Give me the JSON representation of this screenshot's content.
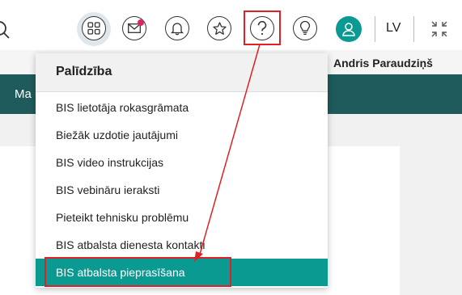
{
  "header": {
    "user_name": "Andris Paraudziņš",
    "language": "LV",
    "icons": [
      "search-icon",
      "apps-icon",
      "messages-icon",
      "bell-icon",
      "star-icon",
      "help-icon",
      "lightbulb-icon",
      "user-avatar-icon",
      "collapse-icon"
    ],
    "notification_color": "#e0245e"
  },
  "nav": {
    "label_fragment": "Ma"
  },
  "help_menu": {
    "title": "Palīdzība",
    "items": [
      "BIS lietotāja rokasgrāmata",
      "Biežāk uzdotie jautājumi",
      "BIS video instrukcijas",
      "BIS vebināru ieraksti",
      "Pieteikt tehnisku problēmu",
      "BIS atbalsta dienesta kontakti",
      "BIS atbalsta pieprasīšana"
    ],
    "selected_index": 6
  },
  "colors": {
    "accent": "#0a9a92",
    "nav_bg": "#1f5a5c",
    "annotation": "#e02027"
  }
}
